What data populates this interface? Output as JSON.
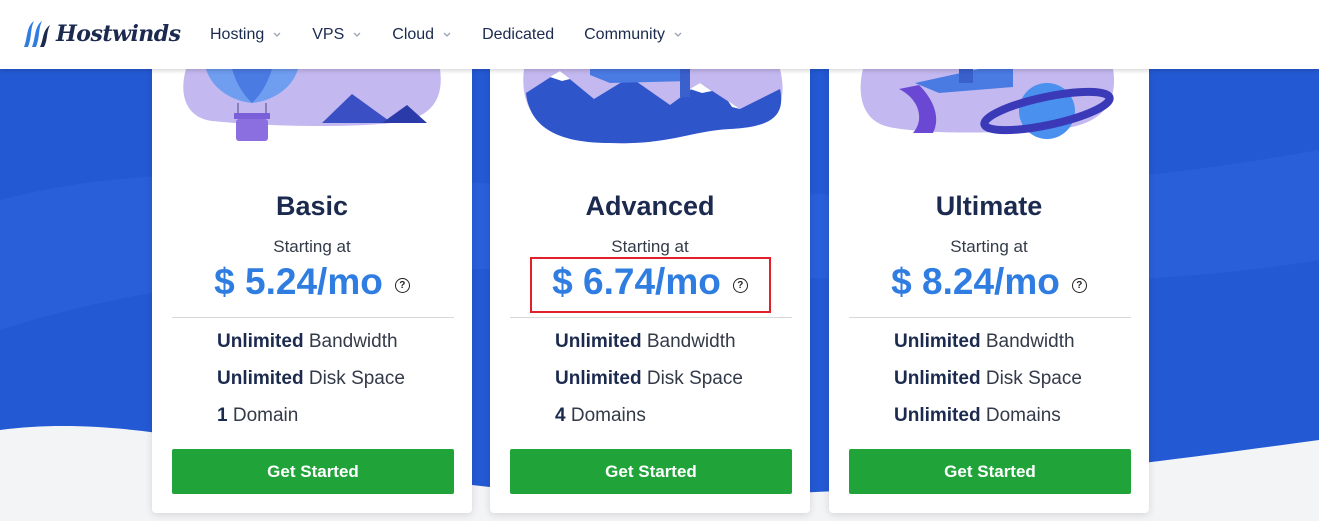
{
  "brand": {
    "name": "Hostwinds"
  },
  "nav": {
    "items": [
      {
        "label": "Hosting",
        "dropdown": true
      },
      {
        "label": "VPS",
        "dropdown": true
      },
      {
        "label": "Cloud",
        "dropdown": true
      },
      {
        "label": "Dedicated",
        "dropdown": false
      },
      {
        "label": "Community",
        "dropdown": true
      }
    ]
  },
  "plans": [
    {
      "name": "Basic",
      "starting": "Starting at",
      "price": "$ 5.24/mo",
      "features": [
        {
          "bold": "Unlimited",
          "text": " Bandwidth"
        },
        {
          "bold": "Unlimited",
          "text": " Disk Space"
        },
        {
          "bold": "1",
          "text": " Domain"
        }
      ],
      "cta": "Get Started"
    },
    {
      "name": "Advanced",
      "starting": "Starting at",
      "price": "$ 6.74/mo",
      "features": [
        {
          "bold": "Unlimited",
          "text": " Bandwidth"
        },
        {
          "bold": "Unlimited",
          "text": " Disk Space"
        },
        {
          "bold": "4",
          "text": " Domains"
        }
      ],
      "cta": "Get Started"
    },
    {
      "name": "Ultimate",
      "starting": "Starting at",
      "price": "$ 8.24/mo",
      "features": [
        {
          "bold": "Unlimited",
          "text": " Bandwidth"
        },
        {
          "bold": "Unlimited",
          "text": " Disk Space"
        },
        {
          "bold": "Unlimited",
          "text": " Domains"
        }
      ],
      "cta": "Get Started"
    }
  ],
  "help_symbol": "?",
  "colors": {
    "background": "#2459d4",
    "price": "#2f7de1",
    "button": "#20a43a",
    "highlight": "#e0202a",
    "text_dark": "#1b2a4e"
  }
}
